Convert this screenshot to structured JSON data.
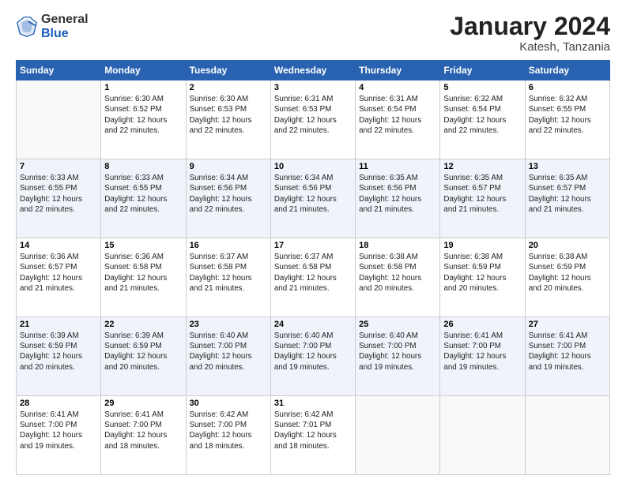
{
  "logo": {
    "general": "General",
    "blue": "Blue"
  },
  "header": {
    "month": "January 2024",
    "location": "Katesh, Tanzania"
  },
  "days_of_week": [
    "Sunday",
    "Monday",
    "Tuesday",
    "Wednesday",
    "Thursday",
    "Friday",
    "Saturday"
  ],
  "weeks": [
    [
      {
        "day": "",
        "info": ""
      },
      {
        "day": "1",
        "info": "Sunrise: 6:30 AM\nSunset: 6:52 PM\nDaylight: 12 hours\nand 22 minutes."
      },
      {
        "day": "2",
        "info": "Sunrise: 6:30 AM\nSunset: 6:53 PM\nDaylight: 12 hours\nand 22 minutes."
      },
      {
        "day": "3",
        "info": "Sunrise: 6:31 AM\nSunset: 6:53 PM\nDaylight: 12 hours\nand 22 minutes."
      },
      {
        "day": "4",
        "info": "Sunrise: 6:31 AM\nSunset: 6:54 PM\nDaylight: 12 hours\nand 22 minutes."
      },
      {
        "day": "5",
        "info": "Sunrise: 6:32 AM\nSunset: 6:54 PM\nDaylight: 12 hours\nand 22 minutes."
      },
      {
        "day": "6",
        "info": "Sunrise: 6:32 AM\nSunset: 6:55 PM\nDaylight: 12 hours\nand 22 minutes."
      }
    ],
    [
      {
        "day": "7",
        "info": "Sunrise: 6:33 AM\nSunset: 6:55 PM\nDaylight: 12 hours\nand 22 minutes."
      },
      {
        "day": "8",
        "info": "Sunrise: 6:33 AM\nSunset: 6:55 PM\nDaylight: 12 hours\nand 22 minutes."
      },
      {
        "day": "9",
        "info": "Sunrise: 6:34 AM\nSunset: 6:56 PM\nDaylight: 12 hours\nand 22 minutes."
      },
      {
        "day": "10",
        "info": "Sunrise: 6:34 AM\nSunset: 6:56 PM\nDaylight: 12 hours\nand 21 minutes."
      },
      {
        "day": "11",
        "info": "Sunrise: 6:35 AM\nSunset: 6:56 PM\nDaylight: 12 hours\nand 21 minutes."
      },
      {
        "day": "12",
        "info": "Sunrise: 6:35 AM\nSunset: 6:57 PM\nDaylight: 12 hours\nand 21 minutes."
      },
      {
        "day": "13",
        "info": "Sunrise: 6:35 AM\nSunset: 6:57 PM\nDaylight: 12 hours\nand 21 minutes."
      }
    ],
    [
      {
        "day": "14",
        "info": "Sunrise: 6:36 AM\nSunset: 6:57 PM\nDaylight: 12 hours\nand 21 minutes."
      },
      {
        "day": "15",
        "info": "Sunrise: 6:36 AM\nSunset: 6:58 PM\nDaylight: 12 hours\nand 21 minutes."
      },
      {
        "day": "16",
        "info": "Sunrise: 6:37 AM\nSunset: 6:58 PM\nDaylight: 12 hours\nand 21 minutes."
      },
      {
        "day": "17",
        "info": "Sunrise: 6:37 AM\nSunset: 6:58 PM\nDaylight: 12 hours\nand 21 minutes."
      },
      {
        "day": "18",
        "info": "Sunrise: 6:38 AM\nSunset: 6:58 PM\nDaylight: 12 hours\nand 20 minutes."
      },
      {
        "day": "19",
        "info": "Sunrise: 6:38 AM\nSunset: 6:59 PM\nDaylight: 12 hours\nand 20 minutes."
      },
      {
        "day": "20",
        "info": "Sunrise: 6:38 AM\nSunset: 6:59 PM\nDaylight: 12 hours\nand 20 minutes."
      }
    ],
    [
      {
        "day": "21",
        "info": "Sunrise: 6:39 AM\nSunset: 6:59 PM\nDaylight: 12 hours\nand 20 minutes."
      },
      {
        "day": "22",
        "info": "Sunrise: 6:39 AM\nSunset: 6:59 PM\nDaylight: 12 hours\nand 20 minutes."
      },
      {
        "day": "23",
        "info": "Sunrise: 6:40 AM\nSunset: 7:00 PM\nDaylight: 12 hours\nand 20 minutes."
      },
      {
        "day": "24",
        "info": "Sunrise: 6:40 AM\nSunset: 7:00 PM\nDaylight: 12 hours\nand 19 minutes."
      },
      {
        "day": "25",
        "info": "Sunrise: 6:40 AM\nSunset: 7:00 PM\nDaylight: 12 hours\nand 19 minutes."
      },
      {
        "day": "26",
        "info": "Sunrise: 6:41 AM\nSunset: 7:00 PM\nDaylight: 12 hours\nand 19 minutes."
      },
      {
        "day": "27",
        "info": "Sunrise: 6:41 AM\nSunset: 7:00 PM\nDaylight: 12 hours\nand 19 minutes."
      }
    ],
    [
      {
        "day": "28",
        "info": "Sunrise: 6:41 AM\nSunset: 7:00 PM\nDaylight: 12 hours\nand 19 minutes."
      },
      {
        "day": "29",
        "info": "Sunrise: 6:41 AM\nSunset: 7:00 PM\nDaylight: 12 hours\nand 18 minutes."
      },
      {
        "day": "30",
        "info": "Sunrise: 6:42 AM\nSunset: 7:00 PM\nDaylight: 12 hours\nand 18 minutes."
      },
      {
        "day": "31",
        "info": "Sunrise: 6:42 AM\nSunset: 7:01 PM\nDaylight: 12 hours\nand 18 minutes."
      },
      {
        "day": "",
        "info": ""
      },
      {
        "day": "",
        "info": ""
      },
      {
        "day": "",
        "info": ""
      }
    ]
  ]
}
